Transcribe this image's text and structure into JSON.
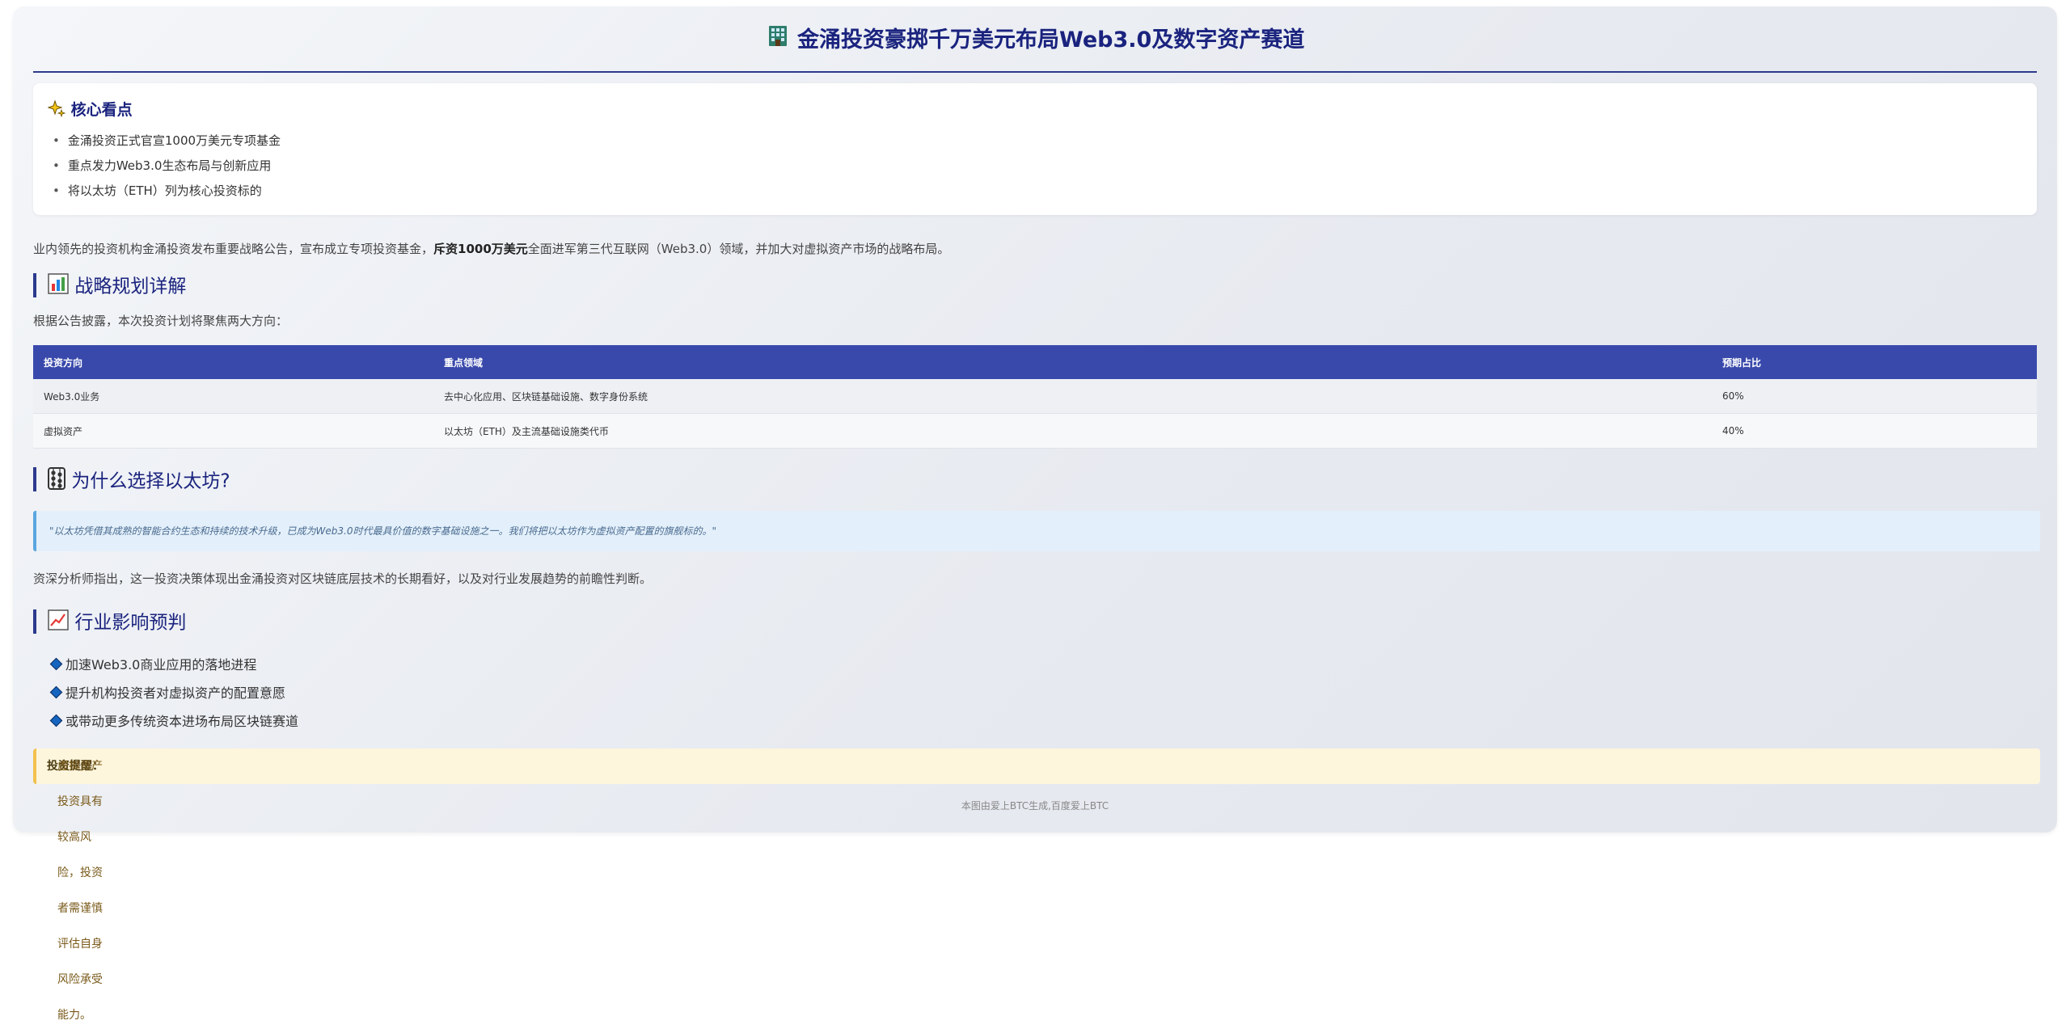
{
  "header": {
    "title": "金涌投资豪掷千万美元布局Web3.0及数字资产赛道"
  },
  "highlights": {
    "title": "核心看点",
    "items": [
      "金涌投资正式官宣1000万美元专项基金",
      "重点发力Web3.0生态布局与创新应用",
      "将以太坊（ETH）列为核心投资标的"
    ]
  },
  "intro": {
    "before": "业内领先的投资机构金涌投资发布重要战略公告，宣布成立专项投资基金，",
    "bold": "斥资1000万美元",
    "after": "全面进军第三代互联网（Web3.0）领域，并加大对虚拟资产市场的战略布局。"
  },
  "strategy": {
    "title": "战略规划详解",
    "lead": "根据公告披露，本次投资计划将聚焦两大方向：",
    "table": {
      "headers": [
        "投资方向",
        "重点领域",
        "预期占比"
      ],
      "rows": [
        [
          "Web3.0业务",
          "去中心化应用、区块链基础设施、数字身份系统",
          "60%"
        ],
        [
          "虚拟资产",
          "以太坊（ETH）及主流基础设施类代币",
          "40%"
        ]
      ]
    }
  },
  "why": {
    "title": "为什么选择以太坊?",
    "quote": "\"以太坊凭借其成熟的智能合约生态和持续的技术升级，已成为Web3.0时代最具价值的数字基础设施之一。我们将把以太坊作为虚拟资产配置的旗舰标的。\"",
    "analysis": "资深分析师指出，这一投资决策体现出金涌投资对区块链底层技术的长期看好，以及对行业发展趋势的前瞻性判断。"
  },
  "impact": {
    "title": "行业影响预判",
    "items": [
      "加速Web3.0商业应用的落地进程",
      "提升机构投资者对虚拟资产的配置意愿",
      "或带动更多传统资本进场布局区块链赛道"
    ]
  },
  "warning": {
    "label": "投资提醒：",
    "text": "虚拟资产投资具有较高风险，投资者需谨慎评估自身风险承受能力。"
  },
  "footer": {
    "text": "本图由爱上BTC生成,百度爱上BTC"
  },
  "icons": {
    "header": "office-building-icon",
    "highlights": "sparkles-icon",
    "strategy": "bar-chart-icon",
    "why": "abacus-icon",
    "impact": "trend-up-chart-icon"
  },
  "colors": {
    "accent": "#1a237e",
    "table_header": "#3949ab",
    "quote_border": "#5aa6df",
    "warning_border": "#f2c14e"
  }
}
